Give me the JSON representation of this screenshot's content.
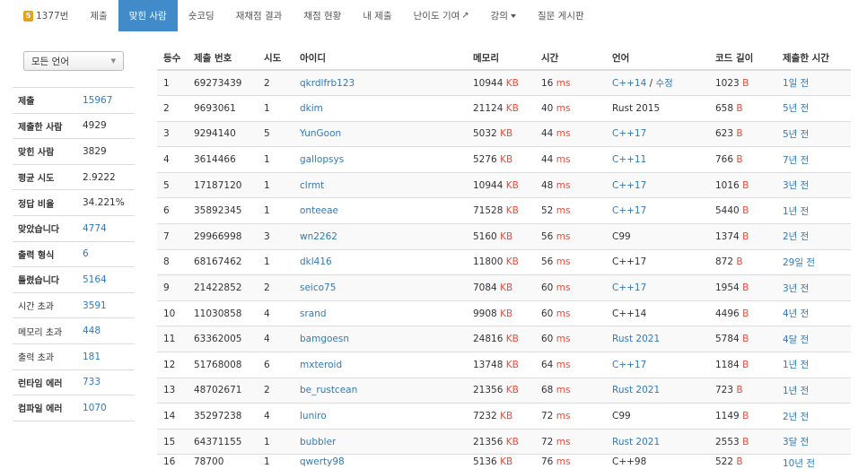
{
  "nav": {
    "problem_number": "1377번",
    "problem_icon": "gold-tier-badge",
    "items": [
      "제출",
      "맞힌 사람",
      "숏코딩",
      "재채점 결과",
      "채점 현황",
      "내 제출",
      "난이도 기여",
      "강의",
      "질문 게시판"
    ],
    "active_index": 1
  },
  "filter": {
    "language_selected": "모든 언어"
  },
  "stats": [
    {
      "label": "제출",
      "value": "15967"
    },
    {
      "label": "제출한 사람",
      "value": "4929"
    },
    {
      "label": "맞힌 사람",
      "value": "3829"
    },
    {
      "label": "평균 시도",
      "value": "2.9222"
    },
    {
      "label": "정답 비율",
      "value": "34.221%"
    },
    {
      "label": "맞았습니다",
      "value": "4774"
    },
    {
      "label": "출력 형식",
      "value": "6"
    },
    {
      "label": "틀렸습니다",
      "value": "5164"
    },
    {
      "label": "시간 초과",
      "value": "3591"
    },
    {
      "label": "메모리 초과",
      "value": "448"
    },
    {
      "label": "출력 초과",
      "value": "181"
    },
    {
      "label": "런타임 에러",
      "value": "733"
    },
    {
      "label": "컴파일 에러",
      "value": "1070"
    }
  ],
  "table": {
    "headers": [
      "등수",
      "제출 번호",
      "시도",
      "아이디",
      "메모리",
      "시간",
      "언어",
      "코드 길이",
      "제출한 시간"
    ],
    "units": {
      "memory": "KB",
      "time": "ms",
      "code": "B"
    },
    "edit_label": "수정",
    "rows": [
      {
        "rank": "1",
        "submission": "69273439",
        "tries": "2",
        "user": "qkrdlfrb123",
        "memory": "10944",
        "time": "16",
        "lang": "C++14",
        "lang_link": true,
        "editable": true,
        "code": "1023",
        "when": "1일 전"
      },
      {
        "rank": "2",
        "submission": "9693061",
        "tries": "1",
        "user": "dkim",
        "memory": "21124",
        "time": "40",
        "lang": "Rust 2015",
        "lang_link": false,
        "editable": false,
        "code": "658",
        "when": "5년 전"
      },
      {
        "rank": "3",
        "submission": "9294140",
        "tries": "5",
        "user": "YunGoon",
        "memory": "5032",
        "time": "44",
        "lang": "C++17",
        "lang_link": true,
        "editable": false,
        "code": "623",
        "when": "5년 전"
      },
      {
        "rank": "4",
        "submission": "3614466",
        "tries": "1",
        "user": "gallopsys",
        "memory": "5276",
        "time": "44",
        "lang": "C++11",
        "lang_link": true,
        "editable": false,
        "code": "766",
        "when": "7년 전"
      },
      {
        "rank": "5",
        "submission": "17187120",
        "tries": "1",
        "user": "clrmt",
        "memory": "10944",
        "time": "48",
        "lang": "C++17",
        "lang_link": true,
        "editable": false,
        "code": "1016",
        "when": "3년 전"
      },
      {
        "rank": "6",
        "submission": "35892345",
        "tries": "1",
        "user": "onteeae",
        "memory": "71528",
        "time": "52",
        "lang": "C++17",
        "lang_link": true,
        "editable": false,
        "code": "5440",
        "when": "1년 전"
      },
      {
        "rank": "7",
        "submission": "29966998",
        "tries": "3",
        "user": "wn2262",
        "memory": "5160",
        "time": "56",
        "lang": "C99",
        "lang_link": false,
        "editable": false,
        "code": "1374",
        "when": "2년 전"
      },
      {
        "rank": "8",
        "submission": "68167462",
        "tries": "1",
        "user": "dkl416",
        "memory": "11800",
        "time": "56",
        "lang": "C++17",
        "lang_link": false,
        "editable": false,
        "code": "872",
        "when": "29일 전"
      },
      {
        "rank": "9",
        "submission": "21422852",
        "tries": "2",
        "user": "seico75",
        "memory": "7084",
        "time": "60",
        "lang": "C++17",
        "lang_link": true,
        "editable": false,
        "code": "1954",
        "when": "3년 전"
      },
      {
        "rank": "10",
        "submission": "11030858",
        "tries": "4",
        "user": "srand",
        "memory": "9908",
        "time": "60",
        "lang": "C++14",
        "lang_link": false,
        "editable": false,
        "code": "4496",
        "when": "4년 전"
      },
      {
        "rank": "11",
        "submission": "63362005",
        "tries": "4",
        "user": "bamgoesn",
        "memory": "24816",
        "time": "60",
        "lang": "Rust 2021",
        "lang_link": true,
        "editable": false,
        "code": "5784",
        "when": "4달 전"
      },
      {
        "rank": "12",
        "submission": "51768008",
        "tries": "6",
        "user": "mxteroid",
        "memory": "13748",
        "time": "64",
        "lang": "C++17",
        "lang_link": true,
        "editable": false,
        "code": "1184",
        "when": "1년 전"
      },
      {
        "rank": "13",
        "submission": "48702671",
        "tries": "2",
        "user": "be_rustcean",
        "memory": "21356",
        "time": "68",
        "lang": "Rust 2021",
        "lang_link": true,
        "editable": false,
        "code": "723",
        "when": "1년 전"
      },
      {
        "rank": "14",
        "submission": "35297238",
        "tries": "4",
        "user": "luniro",
        "memory": "7232",
        "time": "72",
        "lang": "C99",
        "lang_link": false,
        "editable": false,
        "code": "1149",
        "when": "2년 전"
      },
      {
        "rank": "15",
        "submission": "64371155",
        "tries": "1",
        "user": "bubbler",
        "memory": "21356",
        "time": "72",
        "lang": "Rust 2021",
        "lang_link": true,
        "editable": false,
        "code": "2553",
        "when": "3달 전"
      },
      {
        "rank": "16",
        "submission": "78700",
        "tries": "1",
        "user": "qwerty98",
        "memory": "5136",
        "time": "76",
        "lang": "C++98",
        "lang_link": false,
        "editable": false,
        "code": "522",
        "when": "10년 전"
      }
    ]
  }
}
